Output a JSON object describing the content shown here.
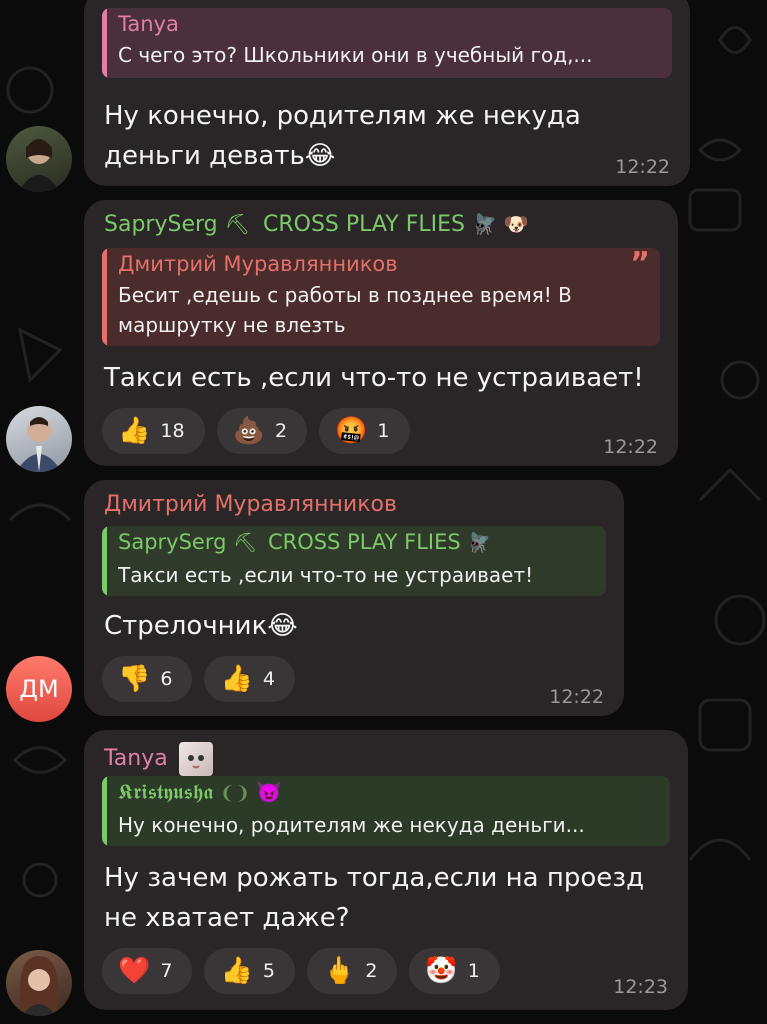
{
  "messages": [
    {
      "quote_name": "Tanya",
      "quote_text": "С чего это? Школьники они в учебный год,...",
      "text_lines": [
        "Ну конечно, родителям же некуда",
        "деньги девать"
      ],
      "text_emoji": "😂",
      "time": "12:22"
    },
    {
      "sender_name": "SaprySerg",
      "sender_tag": "CROSS PLAY FLIES",
      "quote_name": "Дмитрий Муравлянников",
      "quote_text": "Бесит ,едешь с работы в позднее время! В маршрутку не влезть",
      "quote_mark": "”",
      "text": "Такси есть ,если что-то не устраивает!",
      "reactions": [
        {
          "emoji": "👍",
          "count": "18"
        },
        {
          "emoji": "💩",
          "count": "2"
        },
        {
          "emoji": "🤬",
          "count": "1"
        }
      ],
      "time": "12:22"
    },
    {
      "sender_name": "Дмитрий Муравлянников",
      "quote_name": "SaprySerg",
      "quote_tag": "CROSS PLAY FLIES",
      "quote_text": "Такси есть ,если что-то не устраивает!",
      "text": "Стрелочник",
      "text_emoji": "😂",
      "reactions": [
        {
          "emoji": "👎",
          "count": "6"
        },
        {
          "emoji": "👍",
          "count": "4"
        }
      ],
      "time": "12:22",
      "avatar_initials": "ДМ"
    },
    {
      "sender_name": "Tanya",
      "quote_name": "𝕶𝖗𝖎𝖘𝖙𝖞𝖚𝖘𝖍𝖆",
      "quote_text": "Ну конечно, родителям же некуда деньги...",
      "text_lines": [
        "Ну зачем рожать тогда,если на проезд",
        "не хватает даже?"
      ],
      "reactions": [
        {
          "emoji": "❤️",
          "count": "7"
        },
        {
          "emoji": "👍",
          "count": "5"
        },
        {
          "emoji": "🖕",
          "count": "2"
        },
        {
          "emoji": "🤡",
          "count": "1"
        }
      ],
      "time": "12:23"
    }
  ],
  "colors": {
    "tanya": "#e27fa6",
    "saprysergal": "#7cc96a",
    "dmitry": "#e3716a",
    "bubble": "#2a2628",
    "time": "#9c979a"
  }
}
